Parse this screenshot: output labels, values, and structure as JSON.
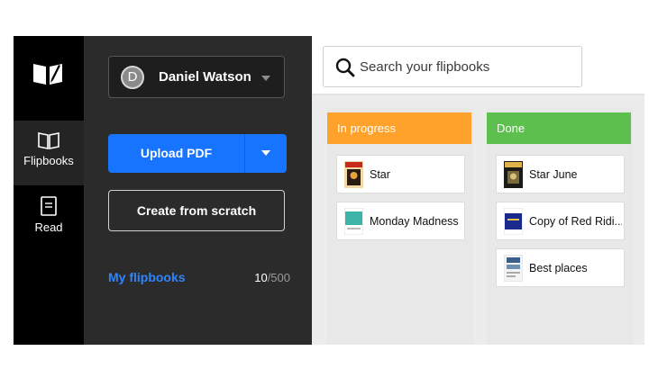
{
  "nav": {
    "logo_icon": "open-book-pen-icon",
    "items": [
      {
        "label": "Flipbooks",
        "icon": "book-open-icon",
        "active": true
      },
      {
        "label": "Read",
        "icon": "document-icon",
        "active": false
      }
    ]
  },
  "user": {
    "initial": "D",
    "name": "Daniel Watson"
  },
  "actions": {
    "upload_label": "Upload PDF",
    "create_label": "Create from scratch"
  },
  "library": {
    "label": "My flipbooks",
    "count_current": "10",
    "count_total": "/500"
  },
  "search": {
    "placeholder": "Search your flipbooks"
  },
  "columns": [
    {
      "title": "In progress",
      "color": "#ffa22b",
      "items": [
        {
          "title": "Star"
        },
        {
          "title": "Monday Madness"
        }
      ]
    },
    {
      "title": "Done",
      "color": "#5dbf4e",
      "items": [
        {
          "title": "Star June"
        },
        {
          "title": "Copy of Red Ridi..."
        },
        {
          "title": "Best places"
        }
      ]
    }
  ],
  "colors": {
    "accent": "#1774ff",
    "link": "#2e86ff"
  }
}
